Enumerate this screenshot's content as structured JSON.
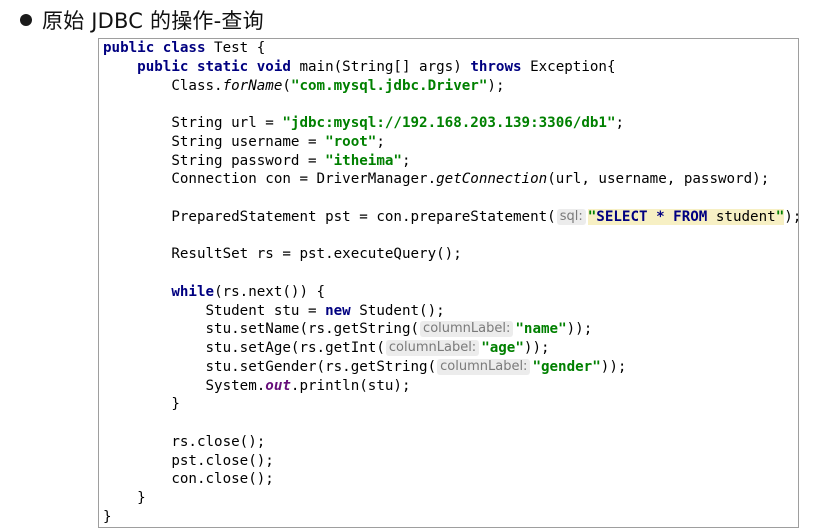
{
  "heading": {
    "title": "原始 JDBC 的操作-查询"
  },
  "code": {
    "l1": {
      "kw1": "public",
      "kw2": "class",
      "rest": " Test {"
    },
    "l2": {
      "kw1": "public",
      "kw2": "static",
      "kw3": "void",
      "mid": " main(String[] args) ",
      "kw4": "throws",
      "rest": " Exception{"
    },
    "l3": {
      "pre": "Class.",
      "method": "forName",
      "open": "(",
      "str": "\"com.mysql.jdbc.Driver\"",
      "close": ");"
    },
    "l5": {
      "pre": "String url = ",
      "str": "\"jdbc:mysql://192.168.203.139:3306/db1\"",
      "close": ";"
    },
    "l6": {
      "pre": "String username = ",
      "str": "\"root\"",
      "close": ";"
    },
    "l7": {
      "pre": "String password = ",
      "str": "\"itheima\"",
      "close": ";"
    },
    "l8": {
      "pre": "Connection con = DriverManager.",
      "method": "getConnection",
      "rest": "(url, username, password);"
    },
    "l10": {
      "pre": "PreparedStatement pst = con.prepareStatement(",
      "hint": "sql:",
      "q1": "\"",
      "kw1": "SELECT",
      "mid": " * ",
      "kw2": "FROM",
      "tail": " student",
      "q2": "\"",
      "close": ");"
    },
    "l12": {
      "text": "ResultSet rs = pst.executeQuery();"
    },
    "l14": {
      "kw": "while",
      "rest": "(rs.next()) {"
    },
    "l15": {
      "pre": "Student stu = ",
      "kw": "new",
      "rest": " Student();"
    },
    "l16": {
      "pre": "stu.setName(rs.getString(",
      "hint": "columnLabel:",
      "str": "\"name\"",
      "close": "));"
    },
    "l17": {
      "pre": "stu.setAge(rs.getInt(",
      "hint": "columnLabel:",
      "str": "\"age\"",
      "close": "));"
    },
    "l18": {
      "pre": "stu.setGender(rs.getString(",
      "hint": "columnLabel:",
      "str": "\"gender\"",
      "close": "));"
    },
    "l19": {
      "pre": "System.",
      "field": "out",
      "rest": ".println(stu);"
    },
    "l20": {
      "text": "}"
    },
    "l22": {
      "text": "rs.close();"
    },
    "l23": {
      "text": "pst.close();"
    },
    "l24": {
      "text": "con.close();"
    },
    "l25": {
      "text": "}"
    },
    "l26": {
      "text": "}"
    }
  }
}
